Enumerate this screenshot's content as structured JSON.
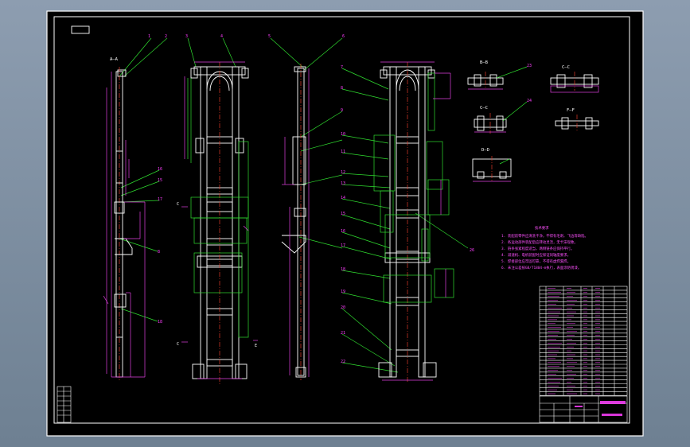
{
  "sheet": {
    "section_titles": [
      "B—B",
      "A—A",
      "C—C",
      "C—C",
      "F—F",
      "D—D"
    ],
    "requirements_title": "技术要求",
    "requirements": [
      "1. 装配前零件应清洗干净，不得有毛刺、飞边等缺陷。",
      "2. 各运动部件装配后应转动灵活，无卡滞现象。",
      "3. 链条张紧程度适当，两侧链条应保持平行。",
      "4. 减速机、电机装配时应保证同轴度要求。",
      "5. 焊接部位应牢固可靠，不得有虚焊漏焊。",
      "6. 未注公差按GB/T1804-m执行，表面涂防锈漆。"
    ]
  },
  "colors": {
    "background": "#8d9db0",
    "sheet": "#000000",
    "outline": "#ffffff",
    "leader": "#2fdc2f",
    "dimension": "#e040e0",
    "centerline": "#e03a2a"
  }
}
